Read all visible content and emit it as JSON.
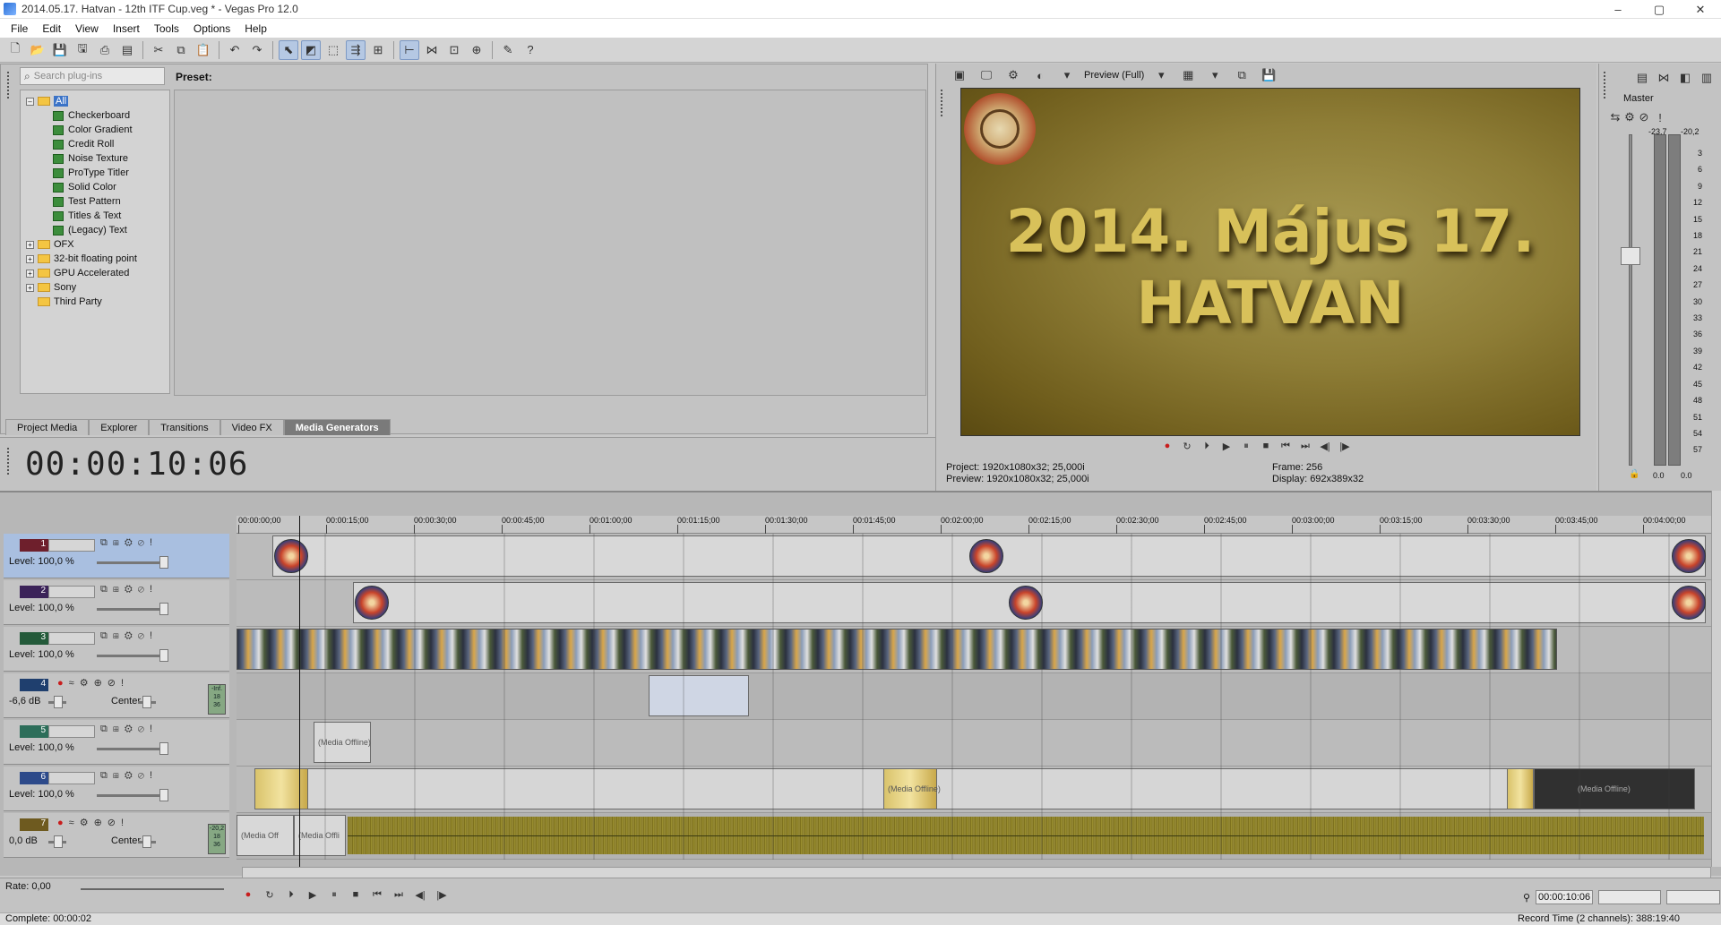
{
  "window": {
    "title": "2014.05.17. Hatvan - 12th ITF Cup.veg * - Vegas Pro 12.0",
    "controls": [
      "–",
      "▢",
      "✕"
    ]
  },
  "menu": [
    "File",
    "Edit",
    "View",
    "Insert",
    "Tools",
    "Options",
    "Help"
  ],
  "plugins": {
    "search_placeholder": "Search plug-ins",
    "preset_label": "Preset:",
    "tree": [
      {
        "label": "All",
        "level": 0,
        "type": "folder",
        "expander": "–",
        "selected": true
      },
      {
        "label": "Checkerboard",
        "level": 1,
        "type": "generator"
      },
      {
        "label": "Color Gradient",
        "level": 1,
        "type": "generator"
      },
      {
        "label": "Credit Roll",
        "level": 1,
        "type": "generator"
      },
      {
        "label": "Noise Texture",
        "level": 1,
        "type": "generator"
      },
      {
        "label": "ProType Titler",
        "level": 1,
        "type": "generator"
      },
      {
        "label": "Solid Color",
        "level": 1,
        "type": "generator"
      },
      {
        "label": "Test Pattern",
        "level": 1,
        "type": "generator"
      },
      {
        "label": "Titles & Text",
        "level": 1,
        "type": "generator"
      },
      {
        "label": "(Legacy) Text",
        "level": 1,
        "type": "generator"
      },
      {
        "label": "OFX",
        "level": 0,
        "type": "folder",
        "expander": "+"
      },
      {
        "label": "32-bit floating point",
        "level": 0,
        "type": "folder",
        "expander": "+"
      },
      {
        "label": "GPU Accelerated",
        "level": 0,
        "type": "folder",
        "expander": "+"
      },
      {
        "label": "Sony",
        "level": 0,
        "type": "folder",
        "expander": "+"
      },
      {
        "label": "Third Party",
        "level": 0,
        "type": "folder",
        "expander": ""
      }
    ]
  },
  "tabs": [
    {
      "label": "Project Media",
      "active": false
    },
    {
      "label": "Explorer",
      "active": false
    },
    {
      "label": "Transitions",
      "active": false
    },
    {
      "label": "Video FX",
      "active": false
    },
    {
      "label": "Media Generators",
      "active": true
    }
  ],
  "timecode": "00:00:10:06",
  "preview": {
    "mode": "Preview (Full)",
    "title_line1": "2014. Május 17.",
    "title_line2": "HATVAN",
    "project_label": "Project:",
    "project_value": "1920x1080x32; 25,000i",
    "preview_label": "Preview:",
    "preview_value": "1920x1080x32; 25,000i",
    "frame_label": "Frame:",
    "frame_value": "256",
    "display_label": "Display:",
    "display_value": "692x389x32"
  },
  "master": {
    "label": "Master",
    "peak_left": "-23,7",
    "peak_right": "-20,2",
    "bottom_left": "0.0",
    "bottom_right": "0.0",
    "scale": [
      "3",
      "6",
      "9",
      "12",
      "15",
      "18",
      "21",
      "24",
      "27",
      "30",
      "33",
      "36",
      "39",
      "42",
      "45",
      "48",
      "51",
      "54",
      "57"
    ]
  },
  "ruler": [
    "00:00:00;00",
    "00:00:15;00",
    "00:00:30;00",
    "00:00:45;00",
    "00:01:00;00",
    "00:01:15;00",
    "00:01:30;00",
    "00:01:45;00",
    "00:02:00;00",
    "00:02:15;00",
    "00:02:30;00",
    "00:02:45;00",
    "00:03:00;00",
    "00:03:15;00",
    "00:03:30;00",
    "00:03:45;00",
    "00:04:00;00"
  ],
  "tracks": [
    {
      "number": "1",
      "kind": "video",
      "level_text": "Level: 100,0 %",
      "selected": true,
      "color": "#6e1f2c"
    },
    {
      "number": "2",
      "kind": "video",
      "level_text": "Level: 100,0 %",
      "selected": false,
      "color": "#3b2359"
    },
    {
      "number": "3",
      "kind": "video",
      "level_text": "Level: 100,0 %",
      "selected": false,
      "color": "#245a3a"
    },
    {
      "number": "4",
      "kind": "audio",
      "level_text": "-6,6 dB",
      "pan_text": "Center",
      "vu_top": "-Inf.",
      "vu_mid": "18",
      "vu_bot": "36",
      "selected": false,
      "color": "#1f3f6e"
    },
    {
      "number": "5",
      "kind": "video",
      "level_text": "Level: 100,0 %",
      "selected": false,
      "color": "#2d6e5a"
    },
    {
      "number": "6",
      "kind": "video",
      "level_text": "Level: 100,0 %",
      "selected": false,
      "color": "#2d4a8a"
    },
    {
      "number": "7",
      "kind": "audio",
      "level_text": "0,0 dB",
      "pan_text": "Center",
      "vu_top": "-20,2",
      "vu_mid": "18",
      "vu_bot": "36",
      "selected": false,
      "color": "#6e5a1f"
    }
  ],
  "clip_labels": {
    "offline": "(Media Offline)",
    "offline_short": "(Media Offli",
    "offline_mid": "(Media Off"
  },
  "bottom": {
    "rate_label": "Rate: 0,00",
    "timecode": "00:00:10:06",
    "status_left": "Complete: 00:00:02",
    "status_right": "Record Time (2 channels): 388:19:40"
  }
}
